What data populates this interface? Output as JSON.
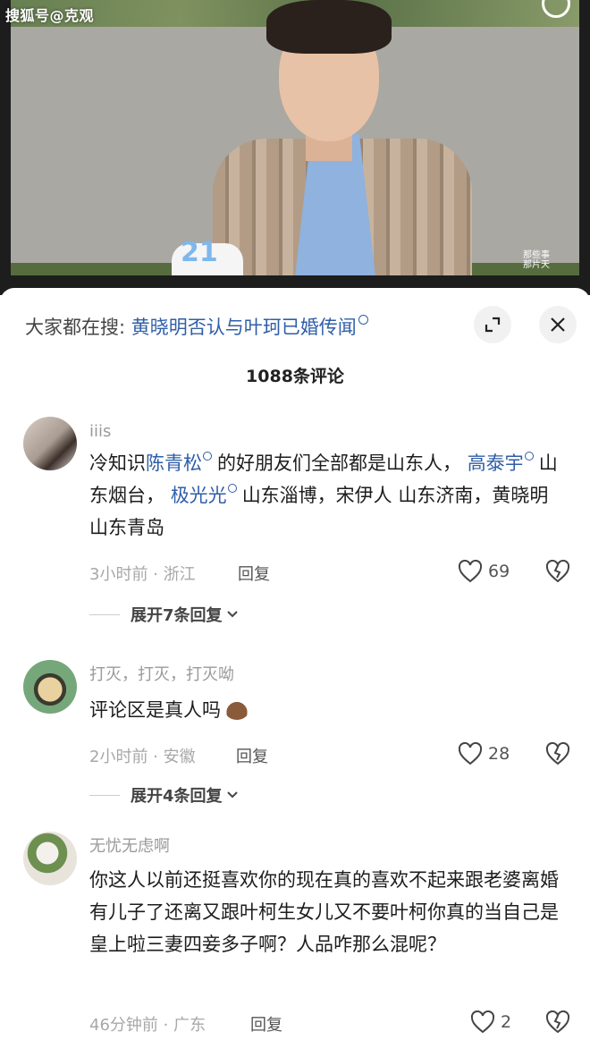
{
  "watermark": "搜狐号@克观",
  "sheet": {
    "search_prefix": "大家都在搜:",
    "search_keyword": "黄晓明否认与叶珂已婚传闻",
    "comment_count": "1088条评论"
  },
  "comments": [
    {
      "username": "iiis",
      "text_parts": [
        "冷知识",
        "陈青松",
        "的好朋友们全部都是山东人，",
        "高泰宇",
        "山东烟台，",
        "极光光",
        "山东淄博，宋伊人 山东济南，黄晓明 山东青岛"
      ],
      "time_location": "3小时前 · 浙江",
      "reply_label": "回复",
      "likes": "69",
      "expand_label": "展开7条回复"
    },
    {
      "username": "打灭，打灭，打灭呦",
      "text": "评论区是真人吗",
      "time_location": "2小时前 · 安徽",
      "reply_label": "回复",
      "likes": "28",
      "expand_label": "展开4条回复"
    },
    {
      "username": "无忧无虑啊",
      "text": "你这人以前还挺喜欢你的现在真的喜欢不起来跟老婆离婚有儿子了还离又跟叶柯生女儿又不要叶柯你真的当自己是皇上啦三妻四妾多子啊？人品咋那么混呢？",
      "time_location": "46分钟前 · 广东",
      "reply_label": "回复",
      "likes": "2"
    }
  ]
}
